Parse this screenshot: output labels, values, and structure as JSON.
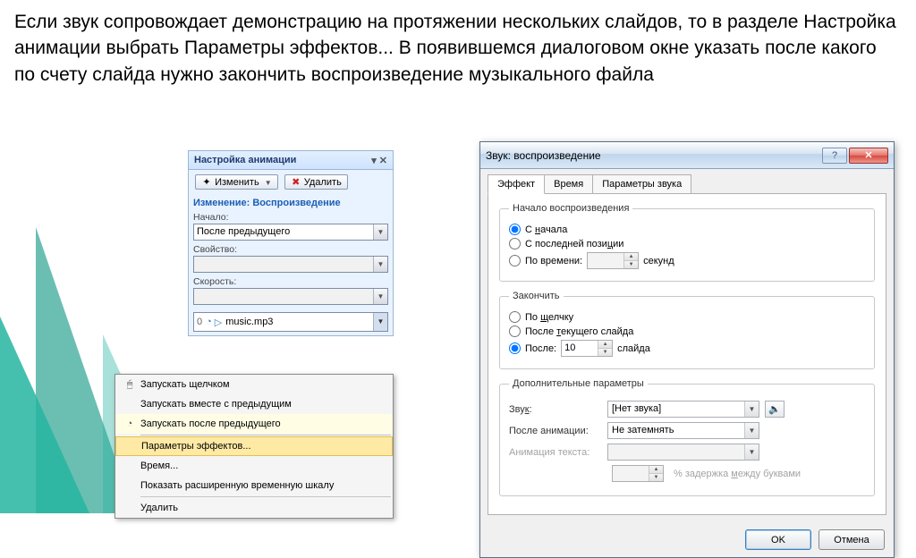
{
  "description": "Если звук сопровождает демонстрацию на протяжении нескольких слайдов, то в разделе Настройка анимации выбрать Параметры эффектов... В появившемся диалоговом окне указать после какого по счету слайда нужно закончить воспроизведение музыкального файла",
  "anim_panel": {
    "title": "Настройка анимации",
    "change_btn": "Изменить",
    "delete_btn": "Удалить",
    "subtitle": "Изменение: Воспроизведение",
    "label_start": "Начало:",
    "start_value": "После предыдущего",
    "label_property": "Свойство:",
    "label_speed": "Скорость:",
    "list_item_num": "0",
    "list_item_text": "music.mp3"
  },
  "ctx": {
    "on_click": "Запускать щелчком",
    "with_prev": "Запускать вместе с предыдущим",
    "after_prev": "Запускать после предыдущего",
    "effect_params": "Параметры эффектов...",
    "timing": "Время...",
    "show_timeline": "Показать расширенную временную шкалу",
    "delete": "Удалить"
  },
  "dlg": {
    "title": "Звук: воспроизведение",
    "tabs": {
      "effect": "Эффект",
      "timing": "Время",
      "sound": "Параметры звука"
    },
    "fs_start": {
      "legend": "Начало воспроизведения",
      "from_start": "С начала",
      "from_last": "С последней позиции",
      "by_time": "По времени:",
      "seconds": "секунд"
    },
    "fs_stop": {
      "legend": "Закончить",
      "on_click": "По щелчку",
      "after_current": "После текущего слайда",
      "after": "После:",
      "after_value": "10",
      "after_unit": "слайда"
    },
    "fs_extra": {
      "legend": "Дополнительные параметры",
      "sound_label": "Звук:",
      "sound_value": "[Нет звука]",
      "after_anim_label": "После анимации:",
      "after_anim_value": "Не затемнять",
      "text_anim_label": "Анимация текста:",
      "delay_text": "% задержка между буквами"
    },
    "ok": "OK",
    "cancel": "Отмена"
  }
}
